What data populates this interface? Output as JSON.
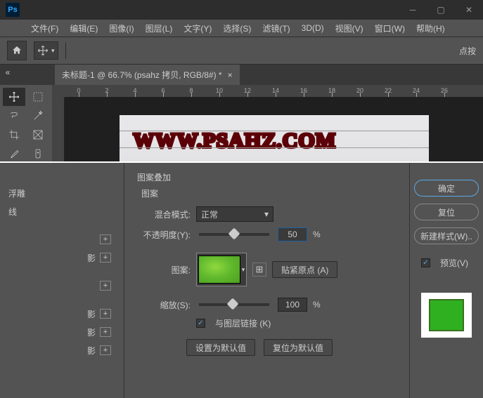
{
  "titlebar": {
    "logo": "Ps"
  },
  "menu": {
    "items": [
      "文件(F)",
      "编辑(E)",
      "图像(I)",
      "图层(L)",
      "文字(Y)",
      "选择(S)",
      "滤镜(T)",
      "3D(D)",
      "视图(V)",
      "窗口(W)",
      "帮助(H)"
    ]
  },
  "optbar": {
    "right": "点按"
  },
  "tab": {
    "title": "未标题-1 @ 66.7% (psahz 拷贝, RGB/8#) *",
    "close": "×"
  },
  "ruler": {
    "marks": [
      "0",
      "2",
      "4",
      "6",
      "8",
      "10",
      "12",
      "14",
      "16",
      "18",
      "20",
      "22",
      "24",
      "26"
    ]
  },
  "canvas": {
    "watermark": "WWW.PSAHZ.COM"
  },
  "styles": {
    "items": [
      "浮雕",
      "线",
      "影",
      "影",
      "影",
      "影"
    ]
  },
  "dialog": {
    "section": "图案叠加",
    "sub": "图案",
    "blend_label": "混合模式:",
    "blend_value": "正常",
    "opacity_label": "不透明度(Y):",
    "opacity_value": "50",
    "opacity_unit": "%",
    "pattern_label": "图案:",
    "snap_btn": "贴紧原点 (A)",
    "scale_label": "缩放(S):",
    "scale_value": "100",
    "scale_unit": "%",
    "link_label": "与图层链接 (K)",
    "default_btn": "设置为默认值",
    "reset_btn": "复位为默认值"
  },
  "right": {
    "ok": "确定",
    "cancel": "复位",
    "newstyle": "新建样式(W)..",
    "preview": "预览(V)"
  }
}
